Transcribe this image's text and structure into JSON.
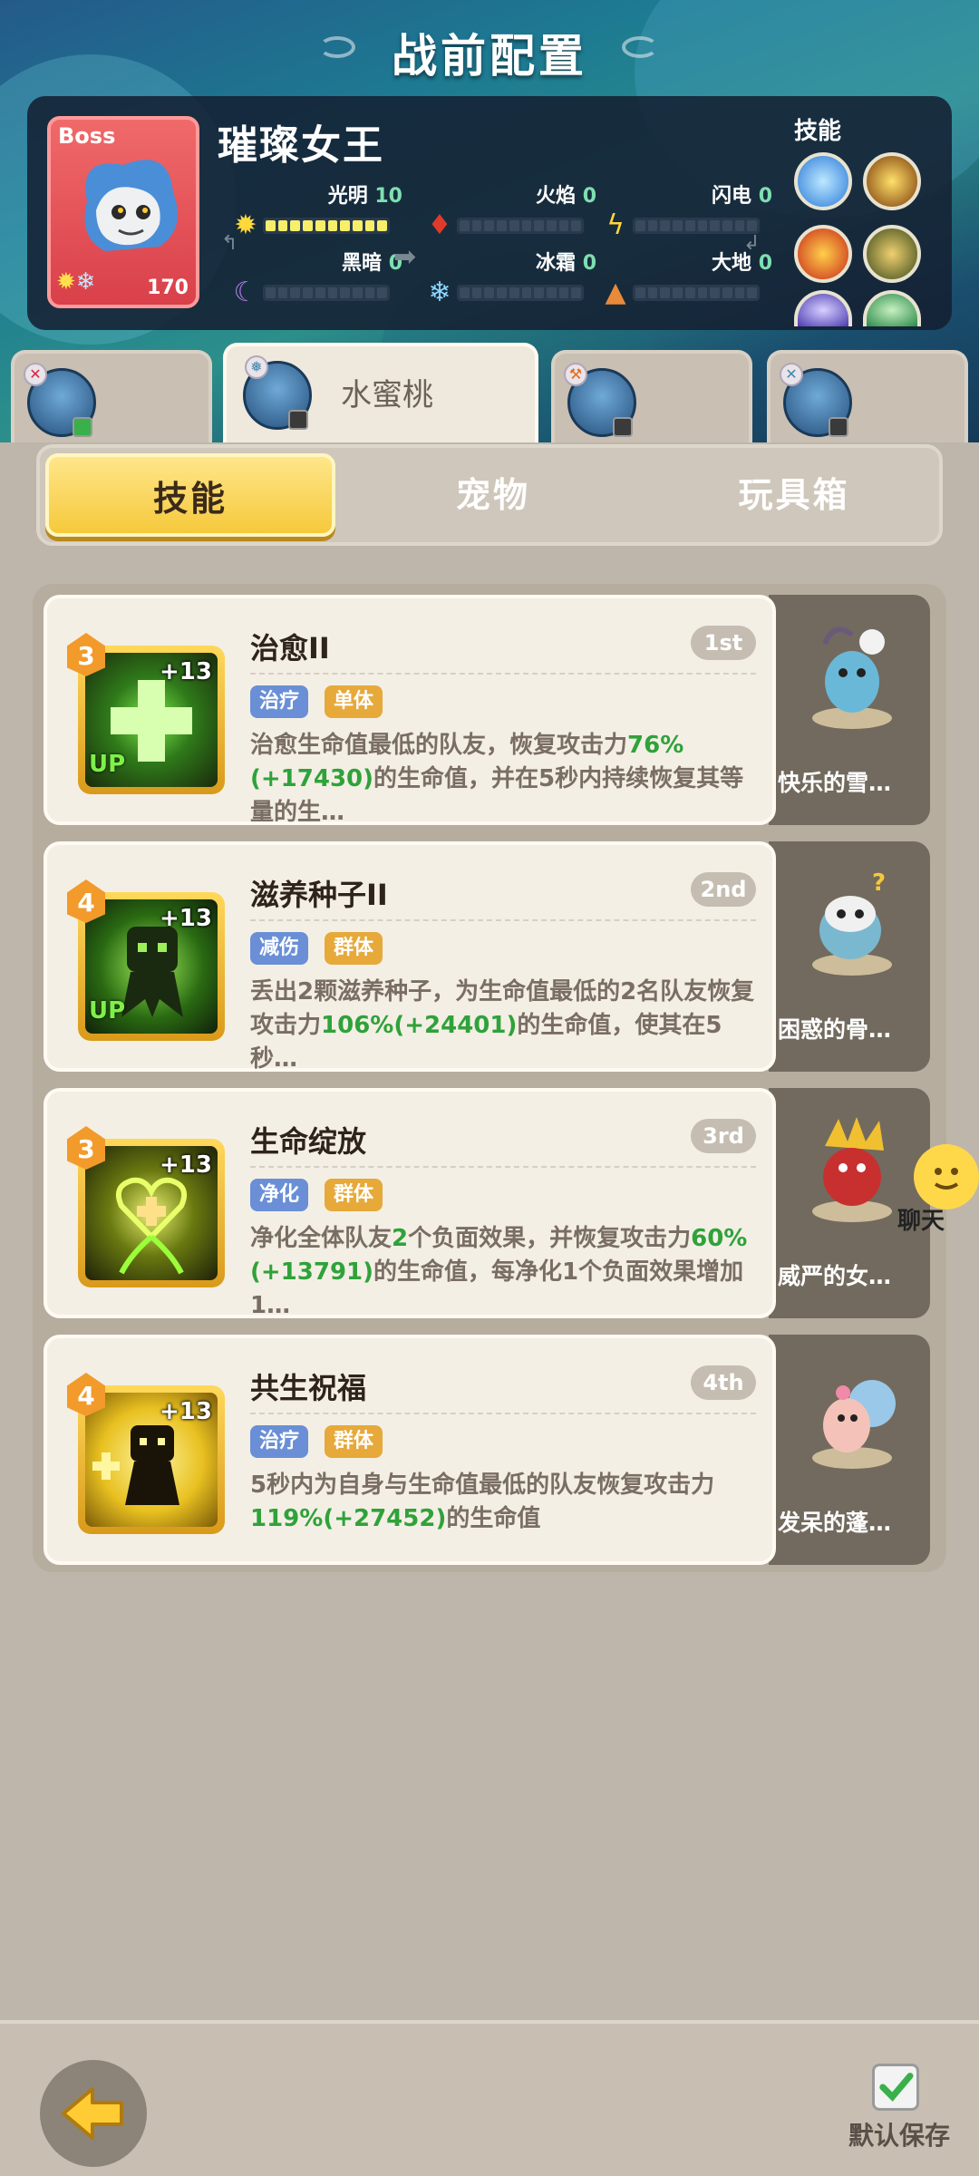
{
  "header": {
    "title": "战前配置"
  },
  "boss": {
    "tag": "Boss",
    "name": "璀璨女王",
    "level": "170",
    "attributes": [
      {
        "label": "光明",
        "value": "10",
        "filled": 10
      },
      {
        "label": "火焰",
        "value": "0",
        "filled": 0
      },
      {
        "label": "闪电",
        "value": "0",
        "filled": 0
      },
      {
        "label": "黑暗",
        "value": "0",
        "filled": 0
      },
      {
        "label": "冰霜",
        "value": "0",
        "filled": 0
      },
      {
        "label": "大地",
        "value": "0",
        "filled": 0
      }
    ],
    "skills_label": "技能"
  },
  "team": {
    "active_name": "水蜜桃"
  },
  "tabs": [
    "技能",
    "宠物",
    "玩具箱"
  ],
  "skills": [
    {
      "name": "治愈II",
      "rank": "1st",
      "level": "3",
      "bonus": "+13",
      "up": "UP",
      "tags": [
        "治疗",
        "单体"
      ],
      "desc_parts": [
        "治愈生命值最低的队友，恢复攻击力",
        "76%(+17430)",
        "的生命值，并在5秒内持续恢复其等量的生…"
      ],
      "pet": "快乐的雪…"
    },
    {
      "name": "滋养种子II",
      "rank": "2nd",
      "level": "4",
      "bonus": "+13",
      "up": "UP",
      "tags": [
        "减伤",
        "群体"
      ],
      "desc_parts": [
        "丢出2颗滋养种子，为生命值最低的2名队友恢复攻击力",
        "106%(+24401)",
        "的生命值，使其在5秒…"
      ],
      "pet": "困惑的骨…"
    },
    {
      "name": "生命绽放",
      "rank": "3rd",
      "level": "3",
      "bonus": "+13",
      "up": "",
      "tags": [
        "净化",
        "群体"
      ],
      "desc_parts": [
        "净化全体队友",
        "2",
        "个负面效果，并恢复攻击力",
        "60%(+13791)",
        "的生命值，每净化1个负面效果增加1…"
      ],
      "pet": "威严的女…"
    },
    {
      "name": "共生祝福",
      "rank": "4th",
      "level": "4",
      "bonus": "+13",
      "up": "",
      "tags": [
        "治疗",
        "群体"
      ],
      "desc_parts": [
        "5秒内为自身与生命值最低的队友恢复攻击力",
        "119%(+27452)",
        "的生命值"
      ],
      "pet": "发呆的蓬…"
    }
  ],
  "chat": {
    "label": "聊天"
  },
  "footer": {
    "save_label": "默认保存"
  },
  "colors": {
    "accent_yellow": "#f6c93c",
    "value_green": "#2fa23a",
    "boss_red": "#d9404a"
  },
  "icons": [
    "back-arrow-icon",
    "checkbox-checked-icon",
    "chat-bubble-icon",
    "sun-icon",
    "fire-icon",
    "lightning-icon",
    "moon-icon",
    "snowflake-icon",
    "earth-icon"
  ]
}
